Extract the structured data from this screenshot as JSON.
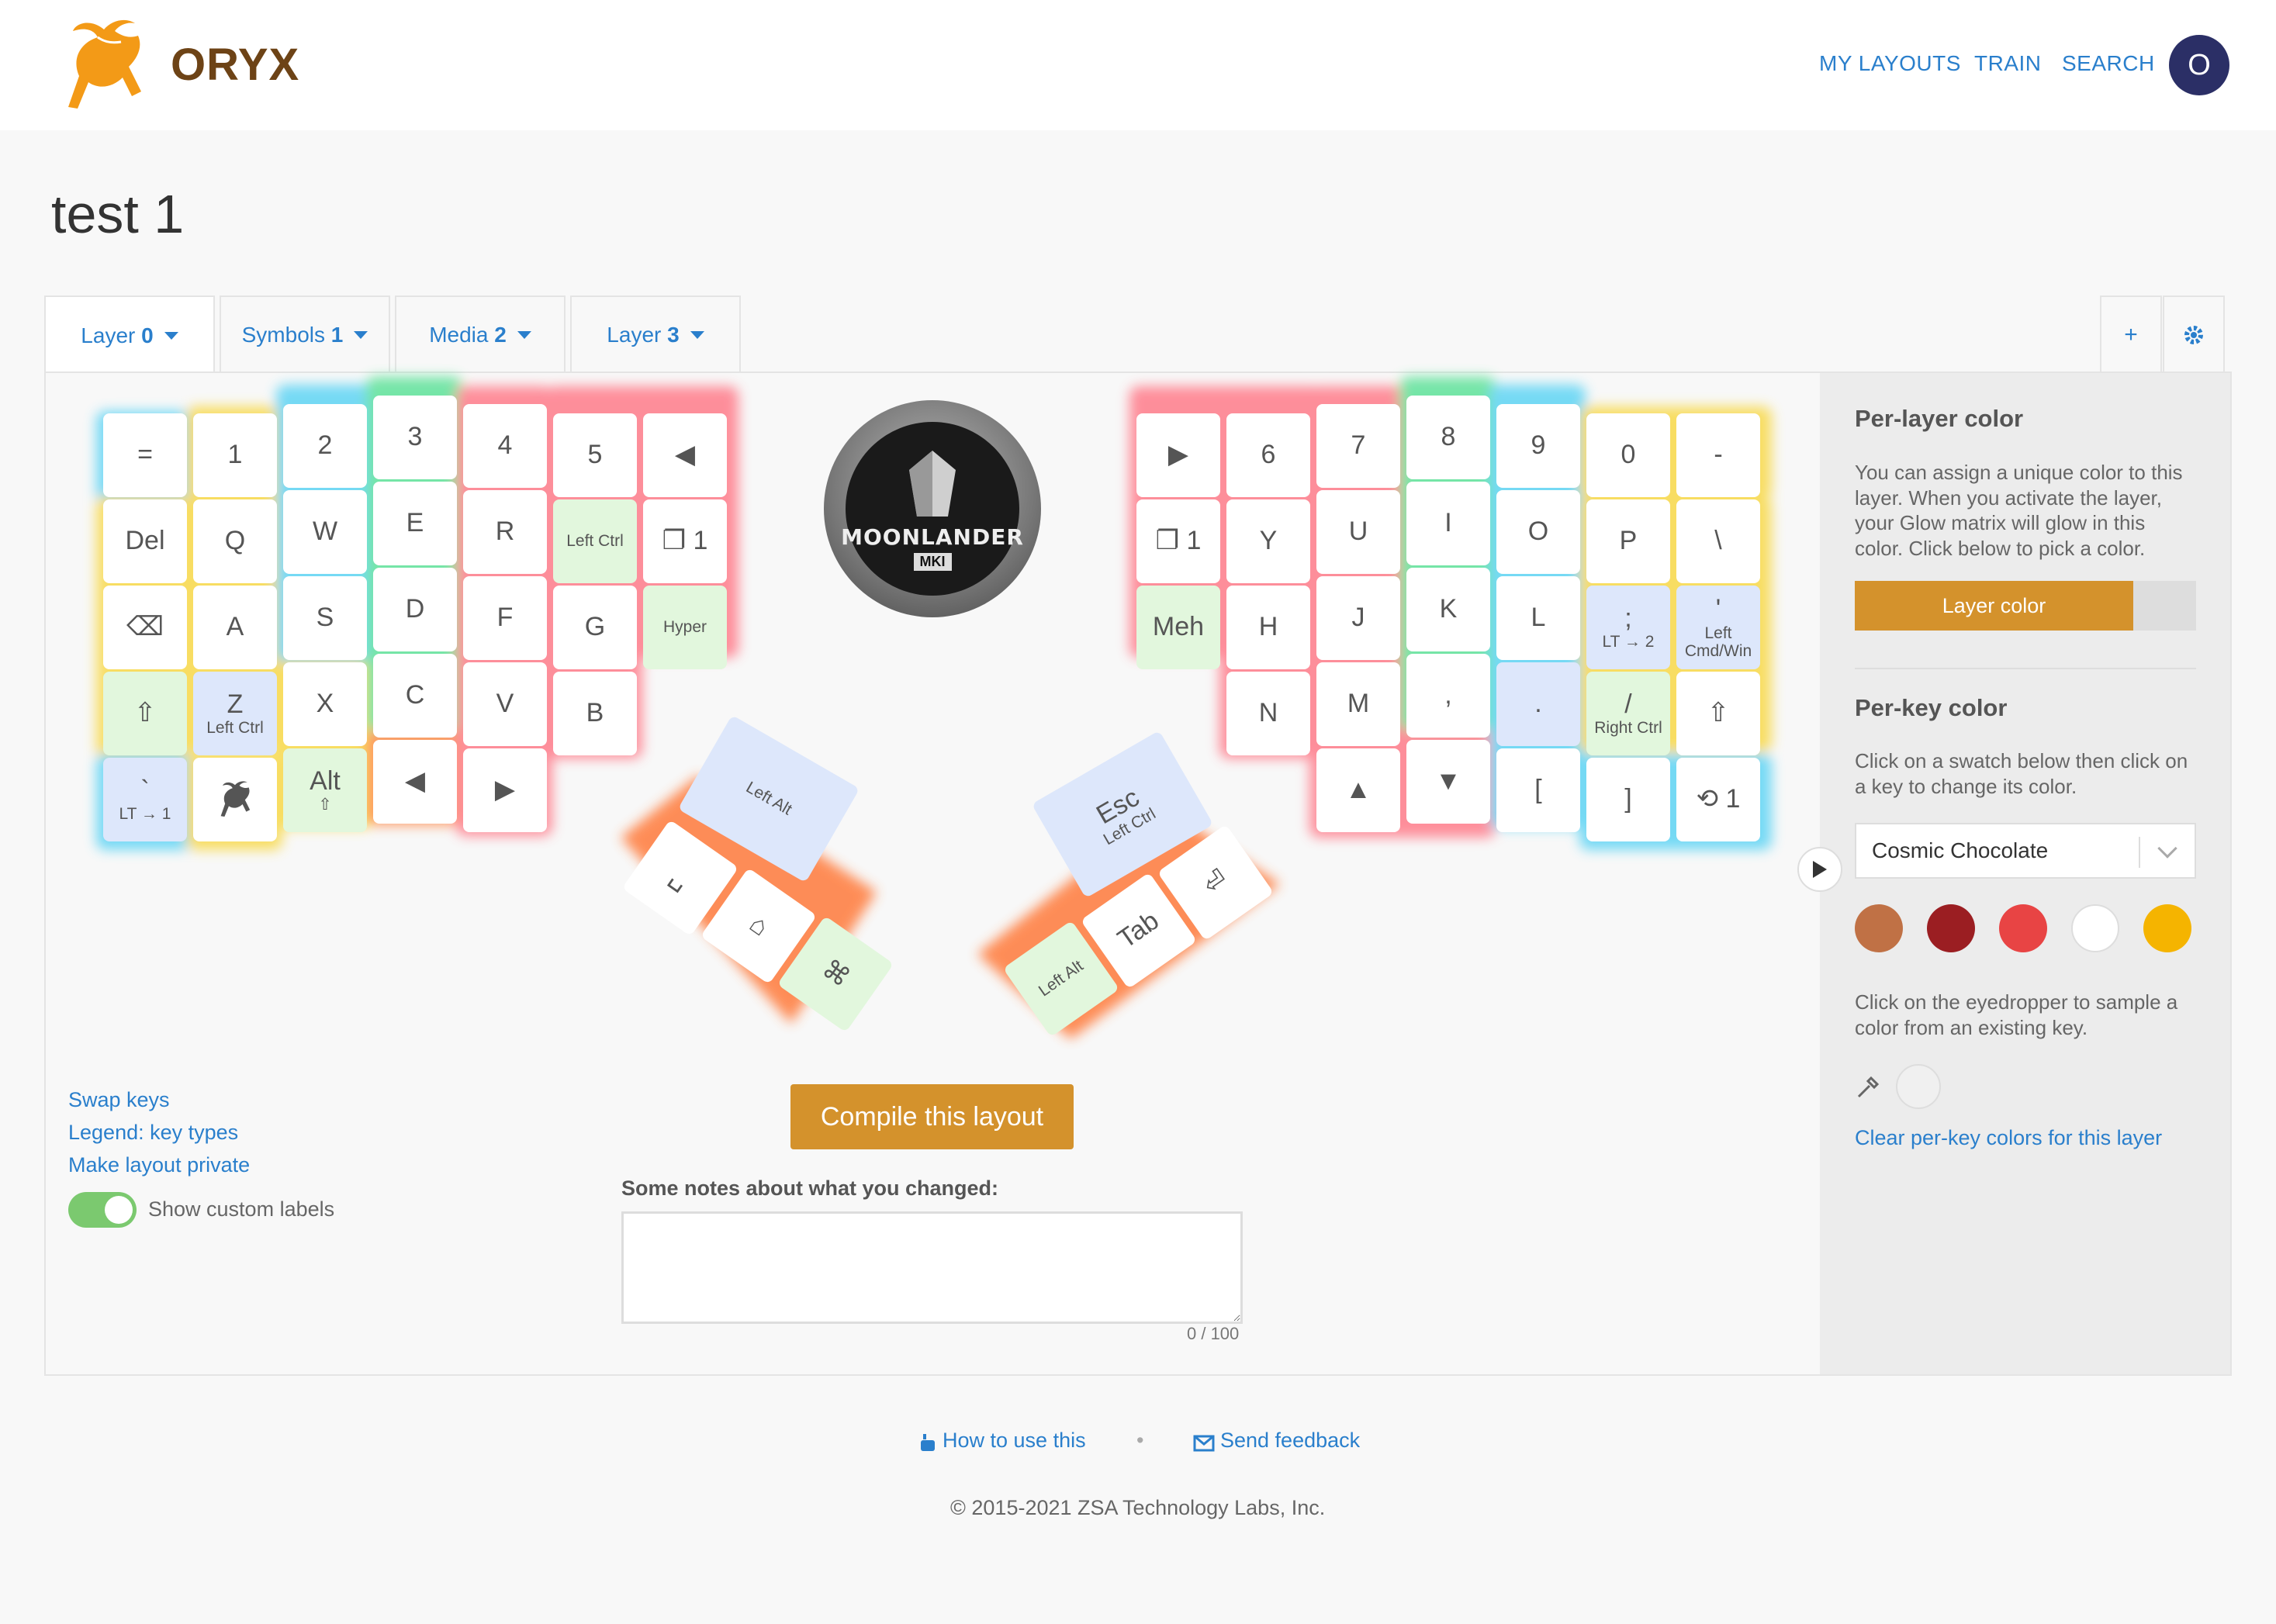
{
  "header": {
    "brand": "ORYX",
    "nav": [
      "MY LAYOUTS",
      "TRAIN",
      "SEARCH"
    ],
    "avatar": "O"
  },
  "title": "test 1",
  "tabs": [
    {
      "label": "Layer",
      "num": "0"
    },
    {
      "label": "Symbols",
      "num": "1"
    },
    {
      "label": "Media",
      "num": "2"
    },
    {
      "label": "Layer",
      "num": "3"
    }
  ],
  "tab_icons": [
    "+",
    "gear-icon"
  ],
  "logo_text": [
    "MOONLANDER",
    "MKI"
  ],
  "keys": {
    "left": [
      [
        "=",
        "1",
        "2",
        "3",
        "4",
        "5",
        "◀"
      ],
      [
        "Del",
        "Q",
        "W",
        "E",
        "R",
        "Left Ctrl",
        "❐ 1"
      ],
      [
        "⌫",
        "A",
        "S",
        "D",
        "F",
        "G",
        "Hyper"
      ],
      [
        "⇧",
        "Z|Left Ctrl",
        "X",
        "C",
        "V",
        "B"
      ],
      [
        "`|LT → 1",
        "oryx-icon",
        "Alt|⇧",
        "◀",
        "▶"
      ]
    ],
    "right": [
      [
        "▶",
        "6",
        "7",
        "8",
        "9",
        "0",
        "-"
      ],
      [
        "❐ 1",
        "Y",
        "U",
        "I",
        "O",
        "P",
        "\\"
      ],
      [
        "Meh",
        "H",
        "J",
        "K",
        "L",
        ";|LT → 2",
        "'|Left Cmd/Win"
      ],
      [
        "N",
        "M",
        ",",
        ".",
        "/|Right Ctrl",
        "⇧"
      ],
      [
        "▲",
        "▼",
        "[",
        "]",
        "⟲ 1"
      ]
    ],
    "thumb_left": [
      "Left Alt",
      "␣",
      "⌂",
      "⌘"
    ],
    "thumb_right": [
      "Esc|Left Ctrl",
      "⏎",
      "Tab",
      "Left Alt"
    ]
  },
  "links": [
    "Swap keys",
    "Legend: key types",
    "Make layout private"
  ],
  "toggle_label": "Show custom labels",
  "compile": "Compile this layout",
  "notes_label": "Some notes about what you changed:",
  "notes_count": "0 / 100",
  "sidebar": {
    "layer_heading": "Per-layer color",
    "layer_text": "You can assign a unique color to this layer. When you activate the layer, your Glow matrix will glow in this color. Click below to pick a color.",
    "layer_btn": "Layer color",
    "key_heading": "Per-key color",
    "key_text": "Click on a swatch below then click on a key to change its color.",
    "select": "Cosmic Chocolate",
    "swatches": [
      "#c07145",
      "#9b1e22",
      "#e84444",
      "#ffffff",
      "#f5b400"
    ],
    "eye_text": "Click on the eyedropper to sample a color from an existing key.",
    "clear": "Clear per-key colors for this layer"
  },
  "footer": {
    "how": "How to use this",
    "sep": "•",
    "feedback": "Send feedback",
    "copy": "© 2015-2021 ZSA Technology Labs, Inc."
  }
}
